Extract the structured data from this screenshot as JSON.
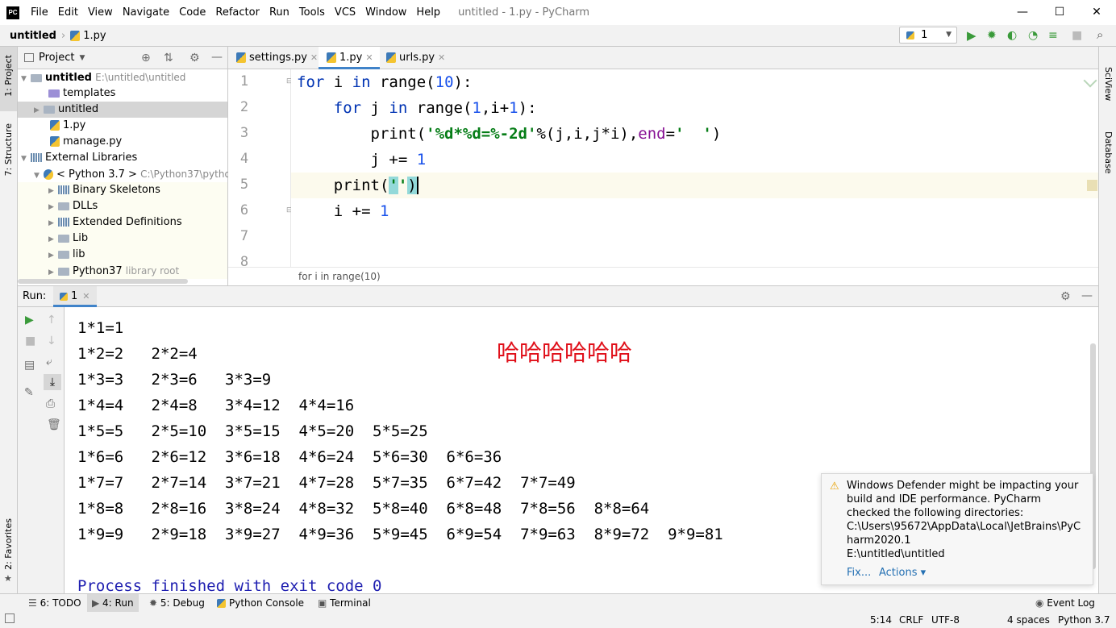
{
  "window": {
    "title": "untitled - 1.py - PyCharm",
    "app_logo": "PC",
    "minimize": "—",
    "maximize": "☐",
    "close": "✕"
  },
  "menu": [
    "File",
    "Edit",
    "View",
    "Navigate",
    "Code",
    "Refactor",
    "Run",
    "Tools",
    "VCS",
    "Window",
    "Help"
  ],
  "navbar": {
    "project": "untitled",
    "file": "1.py",
    "run_config": "1"
  },
  "left_strip": {
    "project": "1: Project",
    "structure": "7: Structure",
    "favorites": "2: Favorites"
  },
  "right_strip": {
    "sciview": "SciView",
    "database": "Database"
  },
  "project_panel": {
    "title": "Project",
    "tree": [
      {
        "label": "untitled",
        "hint": "E:\\untitled\\untitled"
      },
      {
        "label": "templates"
      },
      {
        "label": "untitled"
      },
      {
        "label": "1.py"
      },
      {
        "label": "manage.py"
      },
      {
        "label": "External Libraries"
      },
      {
        "label": "< Python 3.7 >",
        "hint": "C:\\Python37\\python"
      },
      {
        "label": "Binary Skeletons"
      },
      {
        "label": "DLLs"
      },
      {
        "label": "Extended Definitions"
      },
      {
        "label": "Lib"
      },
      {
        "label": "lib"
      },
      {
        "label": "Python37",
        "hint": "library root"
      }
    ]
  },
  "editor": {
    "tabs": [
      {
        "label": "settings.py"
      },
      {
        "label": "1.py"
      },
      {
        "label": "urls.py"
      }
    ],
    "line_numbers": [
      "1",
      "2",
      "3",
      "4",
      "5",
      "6",
      "7",
      "8"
    ],
    "breadcrumb": "for i in range(10)"
  },
  "run_panel": {
    "label": "Run:",
    "tab": "1",
    "output": [
      "1*1=1",
      "1*2=2   2*2=4",
      "1*3=3   2*3=6   3*3=9",
      "1*4=4   2*4=8   3*4=12  4*4=16",
      "1*5=5   2*5=10  3*5=15  4*5=20  5*5=25",
      "1*6=6   2*6=12  3*6=18  4*6=24  5*6=30  6*6=36",
      "1*7=7   2*7=14  3*7=21  4*7=28  5*7=35  6*7=42  7*7=49",
      "1*8=8   2*8=16  3*8=24  4*8=32  5*8=40  6*8=48  7*8=56  8*8=64",
      "1*9=9   2*9=18  3*9=27  4*9=36  5*9=45  6*9=54  7*9=63  8*9=72  9*9=81"
    ],
    "exit": "Process finished with exit code 0",
    "annotation": "哈哈哈哈哈哈"
  },
  "notification": {
    "lines": [
      "Windows Defender might be impacting your",
      "build and IDE performance. PyCharm",
      "checked the following directories:",
      "C:\\Users\\95672\\AppData\\Local\\JetBrains\\PyC",
      "harm2020.1",
      "E:\\untitled\\untitled"
    ],
    "fix": "Fix...",
    "actions": "Actions ▾"
  },
  "tool_windows": [
    {
      "label": "6: TODO"
    },
    {
      "label": "4: Run"
    },
    {
      "label": "5: Debug"
    },
    {
      "label": "Python Console"
    },
    {
      "label": "Terminal"
    }
  ],
  "event_log": "Event Log",
  "status": {
    "position": "5:14",
    "line_sep": "CRLF",
    "encoding": "UTF-8",
    "indent": "4 spaces",
    "interpreter": "Python 3.7"
  },
  "colors": {
    "keyword": "#0033b3",
    "number": "#1750eb",
    "string": "#067d17",
    "param": "#871094",
    "annotation": "#e0101a"
  }
}
